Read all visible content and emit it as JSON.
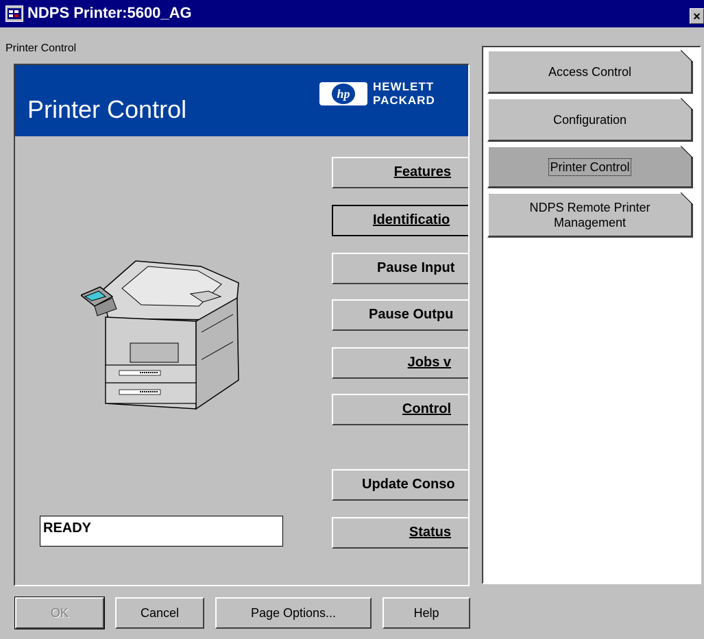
{
  "window": {
    "title": "NDPS Printer:5600_AG",
    "close_glyph": "×"
  },
  "page_label": "Printer Control",
  "banner": {
    "title": "Printer Control",
    "logo_mark": "hp",
    "logo_text": "HEWLETT\nPACKARD",
    "background": "#003f9e"
  },
  "control_buttons": {
    "features": "Features",
    "identification": "Identificatio",
    "pause_input": "Pause Input",
    "pause_output": "Pause Outpu",
    "jobs": "Jobs v",
    "control": "Control",
    "update_console": "Update Conso",
    "status": "Status"
  },
  "status_text": "READY",
  "tabs": [
    {
      "label": "Access Control"
    },
    {
      "label": "Configuration"
    },
    {
      "label": "Printer Control",
      "active": true
    },
    {
      "label": "NDPS Remote Printer Management"
    }
  ],
  "footer": {
    "ok": "OK",
    "cancel": "Cancel",
    "page_options": "Page Options...",
    "help": "Help"
  },
  "colors": {
    "title_bar": "#000080",
    "face": "#c0c0c0"
  }
}
